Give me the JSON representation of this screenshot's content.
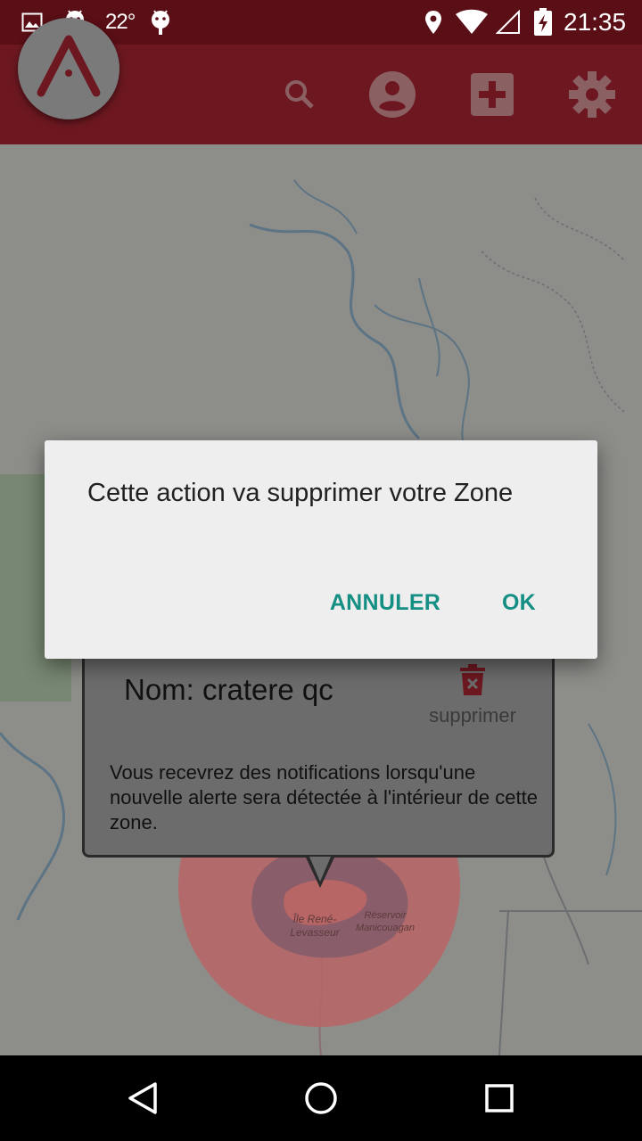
{
  "status_bar": {
    "temperature": "22°",
    "time": "21:35",
    "icons": [
      "image-icon",
      "android-icon",
      "android-icon",
      "location-icon",
      "wifi-icon",
      "signal-icon",
      "battery-charging-icon"
    ]
  },
  "app_bar": {
    "logo_icon": "app-logo-icon",
    "actions": [
      "search-icon",
      "account-icon",
      "add-box-icon",
      "settings-icon"
    ]
  },
  "map": {
    "labels": [
      {
        "text": "Île René-\nLevasseur"
      },
      {
        "text": "Réservoir\nManicouagan"
      }
    ],
    "zone_color": "#e06a6a"
  },
  "zone_popup": {
    "name": "Nom: cratere qc",
    "delete_label": "supprimer",
    "description": "Vous recevrez des notifications lorsqu'une nouvelle alerte sera détectée à l'intérieur de cette zone."
  },
  "dialog": {
    "message": "Cette action va supprimer votre Zone",
    "cancel_label": "ANNULER",
    "ok_label": "OK",
    "accent_color": "#158f84"
  },
  "nav_bar": {
    "buttons": [
      "back-icon",
      "home-icon",
      "recents-icon"
    ]
  }
}
